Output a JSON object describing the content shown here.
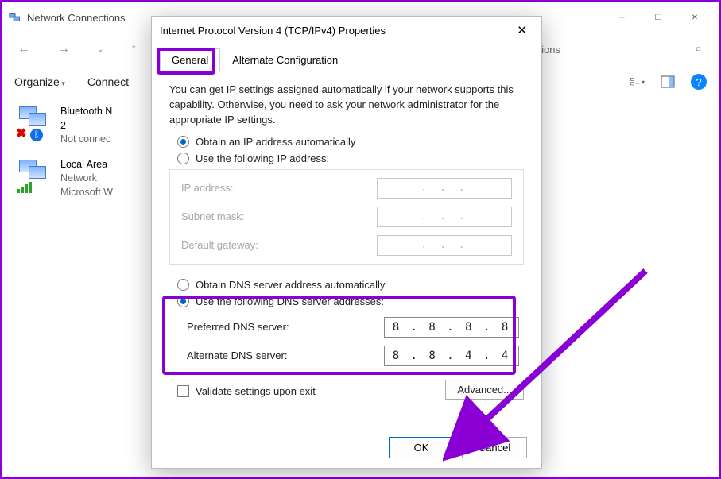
{
  "explorer": {
    "title": "Network Connections",
    "breadcrumb": "ork Connections",
    "toolbar": {
      "organize": "Organize",
      "connect": "Connect"
    },
    "connections": [
      {
        "name": "Bluetooth N",
        "line2": "2",
        "line3": "Not connec"
      },
      {
        "name": "Local Area",
        "line2": "Network",
        "line3": "Microsoft W"
      }
    ]
  },
  "dialog": {
    "title": "Internet Protocol Version 4 (TCP/IPv4) Properties",
    "tabs": {
      "general": "General",
      "alt": "Alternate Configuration"
    },
    "intro": "You can get IP settings assigned automatically if your network supports this capability. Otherwise, you need to ask your network administrator for the appropriate IP settings.",
    "ip_section": {
      "auto": "Obtain an IP address automatically",
      "manual": "Use the following IP address:",
      "labels": {
        "ip": "IP address:",
        "mask": "Subnet mask:",
        "gw": "Default gateway:"
      },
      "placeholder": ".      .      ."
    },
    "dns_section": {
      "auto": "Obtain DNS server address automatically",
      "manual": "Use the following DNS server addresses:",
      "labels": {
        "pref": "Preferred DNS server:",
        "alt": "Alternate DNS server:"
      },
      "values": {
        "pref": "8 . 8 . 8 . 8",
        "alt": "8 . 8 . 4 . 4"
      }
    },
    "validate": "Validate settings upon exit",
    "advanced": "Advanced...",
    "buttons": {
      "ok": "OK",
      "cancel": "Cancel"
    }
  }
}
